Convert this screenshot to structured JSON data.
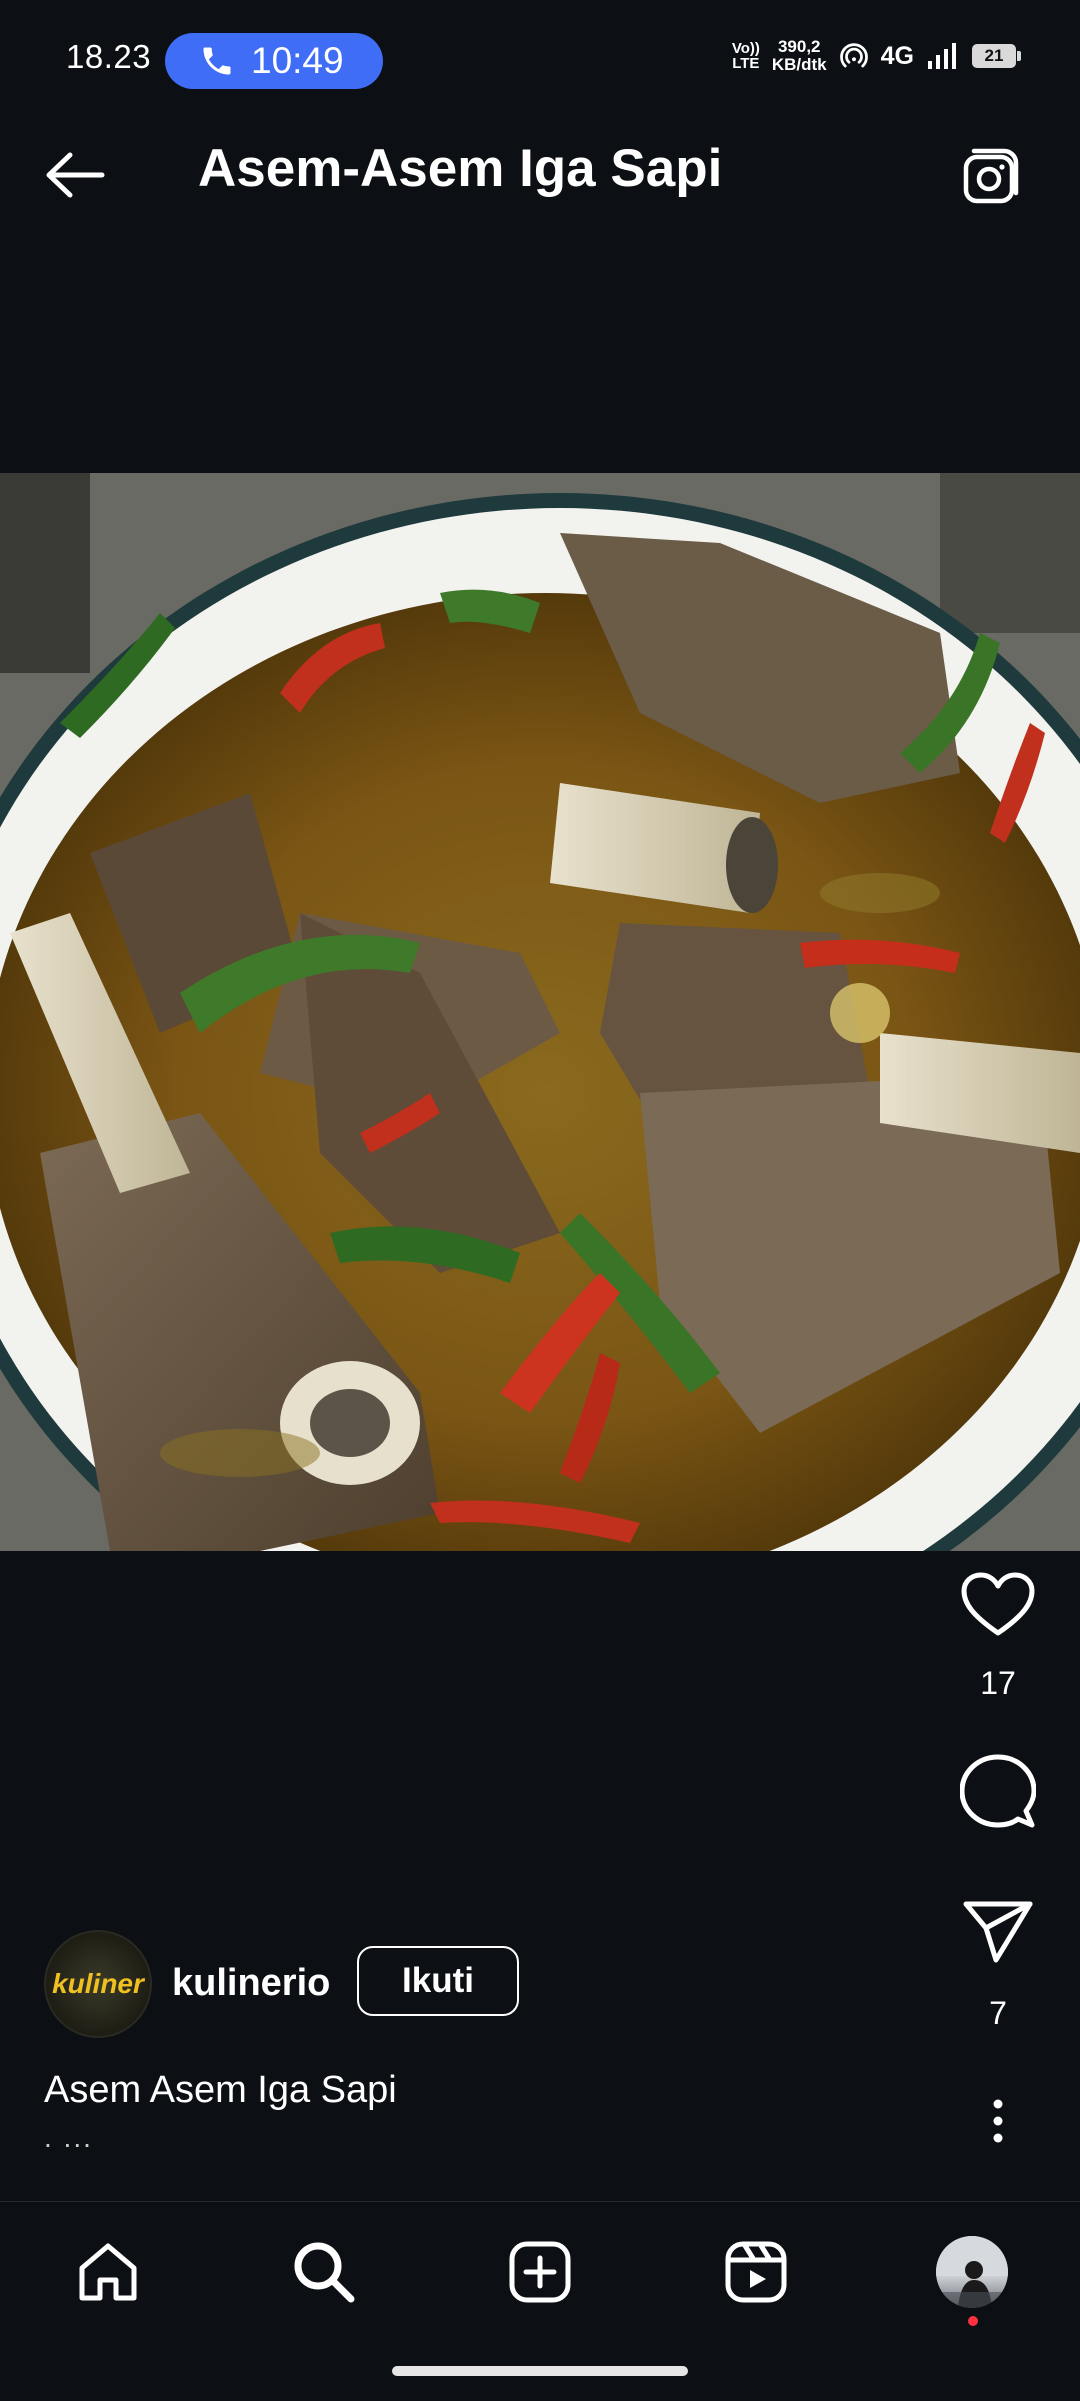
{
  "status_bar": {
    "time": "18.23",
    "call_time": "10:49",
    "volte_top": "Vo))",
    "volte_bottom": "LTE",
    "speed_value": "390,2",
    "speed_unit": "KB/dtk",
    "network": "4G",
    "battery": "21"
  },
  "header": {
    "title": "Asem-Asem Iga Sapi",
    "back_icon": "arrow-left-icon",
    "camera_icon": "camera-icon"
  },
  "post": {
    "likes": "17",
    "shares": "7",
    "author": {
      "username": "kulinerio",
      "avatar_text": "kuliner",
      "follow_label": "Ikuti"
    },
    "caption": "Asem Asem Iga Sapi",
    "caption_more": ". ..."
  },
  "bottom_nav": {
    "items": [
      "home-icon",
      "search-icon",
      "create-icon",
      "reels-icon",
      "profile-avatar"
    ],
    "profile_notification_color": "#ff3040"
  },
  "colors": {
    "background": "#0c1014",
    "call_pill": "#3f6df6"
  }
}
